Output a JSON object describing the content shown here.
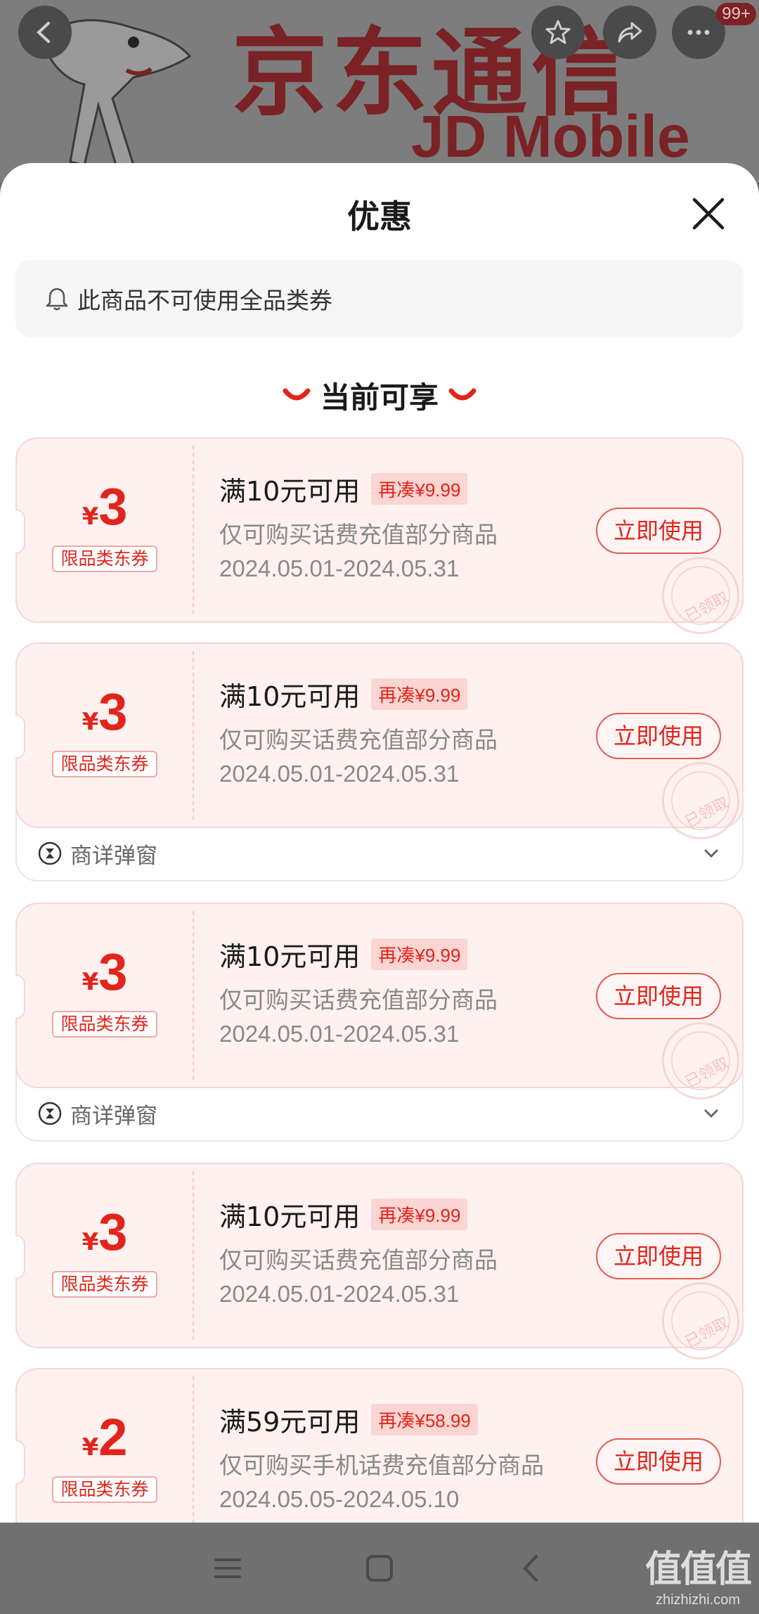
{
  "banner": {
    "brand_cn": "京东通信",
    "brand_en": "JD Mobile",
    "badge": "99+"
  },
  "icons": {
    "back": "back-arrow-icon",
    "favorite": "star-icon",
    "share": "share-icon",
    "more": "more-icon"
  },
  "sheet": {
    "title": "优惠",
    "notice": "此商品不可使用全品类券",
    "section_title": "当前可享"
  },
  "coupons": [
    {
      "yen": "¥",
      "amount": "3",
      "type": "限品类东券",
      "condition": "满10元可用",
      "extra": "再凑¥9.99",
      "scope": "仅可购买话费充值部分商品",
      "date": "2024.05.01-2024.05.31",
      "button": "立即使用",
      "stamp": "已领取",
      "footer": ""
    },
    {
      "yen": "¥",
      "amount": "3",
      "type": "限品类东券",
      "condition": "满10元可用",
      "extra": "再凑¥9.99",
      "scope": "仅可购买话费充值部分商品",
      "date": "2024.05.01-2024.05.31",
      "button": "立即使用",
      "stamp": "已领取",
      "footer": "商详弹窗"
    },
    {
      "yen": "¥",
      "amount": "3",
      "type": "限品类东券",
      "condition": "满10元可用",
      "extra": "再凑¥9.99",
      "scope": "仅可购买话费充值部分商品",
      "date": "2024.05.01-2024.05.31",
      "button": "立即使用",
      "stamp": "已领取",
      "footer": "商详弹窗"
    },
    {
      "yen": "¥",
      "amount": "3",
      "type": "限品类东券",
      "condition": "满10元可用",
      "extra": "再凑¥9.99",
      "scope": "仅可购买话费充值部分商品",
      "date": "2024.05.01-2024.05.31",
      "button": "立即使用",
      "stamp": "已领取",
      "footer": ""
    },
    {
      "yen": "¥",
      "amount": "2",
      "type": "限品类东券",
      "condition": "满59元可用",
      "extra": "再凑¥58.99",
      "scope": "仅可购买手机话费充值部分商品",
      "date": "2024.05.05-2024.05.10",
      "button": "立即使用",
      "stamp": "",
      "footer": ""
    }
  ],
  "watermark": {
    "text": "值值值",
    "domain": "zhizhizhi.com"
  },
  "colors": {
    "accent": "#e1251b",
    "coupon_bg": "#fff1f0"
  }
}
